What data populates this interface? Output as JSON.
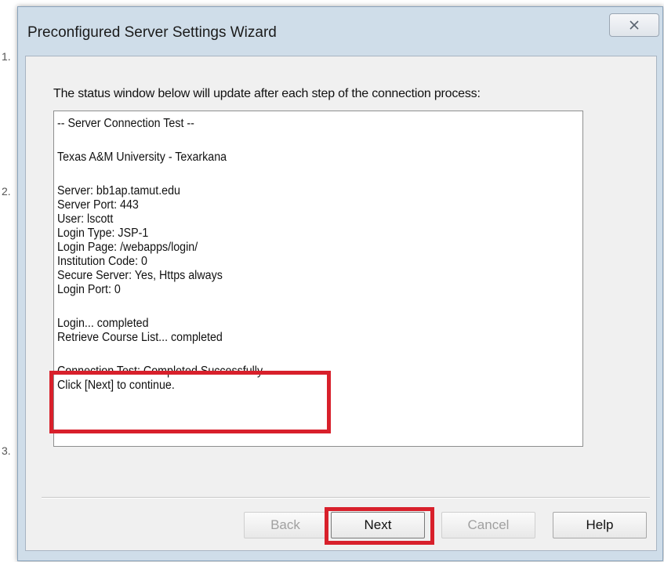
{
  "background": {
    "marks": [
      "1.",
      "2.",
      "3."
    ]
  },
  "dialog": {
    "title": "Preconfigured Server Settings Wizard",
    "instruction": "The status window below will update after each step of the connection process:",
    "status_lines": [
      "-- Server Connection Test --",
      "",
      "Texas A&M University - Texarkana",
      "",
      "Server: bb1ap.tamut.edu",
      "Server Port: 443",
      "User: lscott",
      "Login Type: JSP-1",
      "Login Page: /webapps/login/",
      "Institution Code: 0",
      "Secure Server: Yes, Https always",
      "Login Port: 0",
      "",
      "Login... completed",
      "Retrieve Course List... completed",
      "",
      "Connection Test: Completed Successfully.",
      "Click [Next] to continue."
    ],
    "buttons": {
      "back": "Back",
      "next": "Next",
      "cancel": "Cancel",
      "help": "Help"
    },
    "highlight_color": "#d8202b",
    "close_icon": "close-x-icon"
  }
}
